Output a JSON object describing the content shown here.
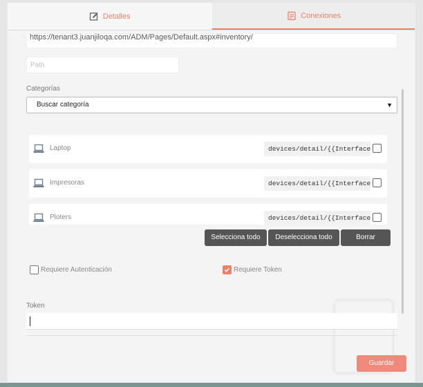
{
  "tabs": [
    {
      "label": "Detalles",
      "icon": "edit-icon",
      "active": false
    },
    {
      "label": "Conexiones",
      "icon": "document-icon",
      "active": true
    }
  ],
  "url_value": "https://tenant3.juanjiloqa.com/ADM/Pages/Default.aspx#inventory/",
  "path_placeholder": "Path",
  "categorias": {
    "label": "Categorías",
    "selected": "Buscar categoría"
  },
  "items": [
    {
      "name": "Laptop",
      "path": "devices/detail/{{InterfaceId}}",
      "checked": false
    },
    {
      "name": "Impresoras",
      "path": "devices/detail/{{InterfaceId}}",
      "checked": false
    },
    {
      "name": "Ploters",
      "path": "devices/detail/{{InterfaceId}}",
      "checked": false
    }
  ],
  "buttons": {
    "select_all": "Selecciona todo",
    "deselect_all": "Deselecciona todo",
    "delete": "Borrar",
    "save": "Guardar"
  },
  "options": {
    "requiere_autenticacion": {
      "label": "Requiere Autenticación",
      "checked": false
    },
    "requiere_token": {
      "label": "Requiere Token",
      "checked": true
    }
  },
  "token": {
    "label": "Token",
    "value": ""
  },
  "colors": {
    "accent": "#e8806a",
    "dark_button": "#555555",
    "save": "#f0897a"
  }
}
